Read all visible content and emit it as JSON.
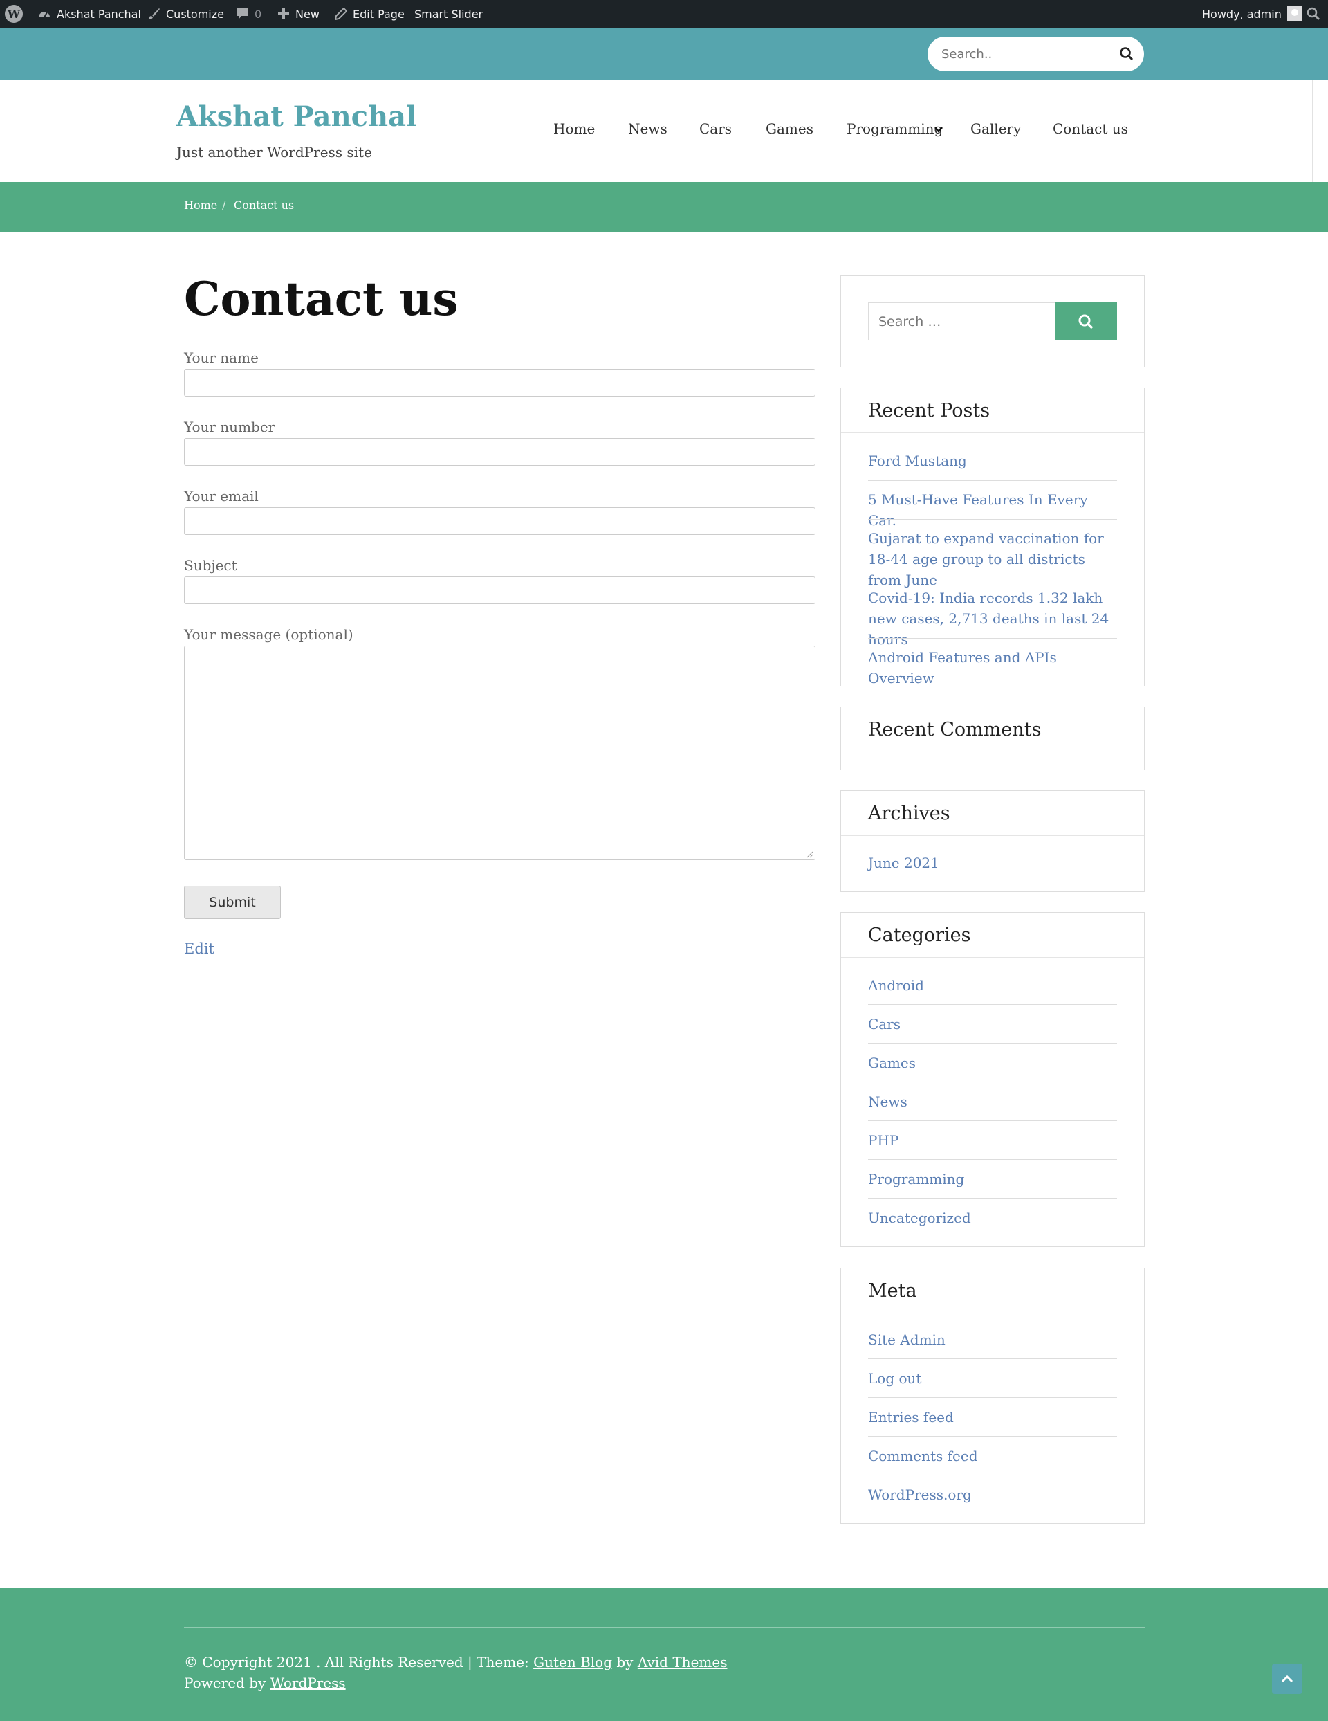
{
  "admin_bar": {
    "site_name": "Akshat Panchal",
    "customize": "Customize",
    "comments_count": "0",
    "new": "New",
    "edit_page": "Edit Page",
    "smart_slider": "Smart Slider",
    "howdy": "Howdy, admin"
  },
  "top_search": {
    "placeholder": "Search.."
  },
  "site": {
    "title": "Akshat Panchal",
    "tagline": "Just another WordPress site",
    "accent_color": "#56a5ae",
    "green_color": "#52ab83"
  },
  "nav": {
    "home": "Home",
    "news": "News",
    "cars": "Cars",
    "games": "Games",
    "programming": "Programming",
    "gallery": "Gallery",
    "contact": "Contact us"
  },
  "breadcrumb": {
    "home": "Home",
    "separator": "/",
    "current": "Contact us"
  },
  "page": {
    "title": "Contact us",
    "labels": {
      "name": "Your name",
      "number": "Your number",
      "email": "Your email",
      "subject": "Subject",
      "message": "Your message (optional)"
    },
    "submit": "Submit",
    "edit": "Edit"
  },
  "sidebar": {
    "search_placeholder": "Search …",
    "recent_posts": {
      "title": "Recent Posts",
      "items": [
        "Ford Mustang",
        "5 Must-Have Features In Every Car.",
        "Gujarat to expand vaccination for 18-44 age group to all districts from June",
        "Covid-19: India records 1.32 lakh new cases, 2,713 deaths in last 24 hours",
        "Android Features and APIs Overview"
      ]
    },
    "recent_comments": {
      "title": "Recent Comments"
    },
    "archives": {
      "title": "Archives",
      "items": [
        "June 2021"
      ]
    },
    "categories": {
      "title": "Categories",
      "items": [
        "Android",
        "Cars",
        "Games",
        "News",
        "PHP",
        "Programming",
        "Uncategorized"
      ]
    },
    "meta": {
      "title": "Meta",
      "items": [
        "Site Admin",
        "Log out",
        "Entries feed",
        "Comments feed",
        "WordPress.org"
      ]
    }
  },
  "footer": {
    "copyright": "© Copyright 2021 . All Rights Reserved | Theme:",
    "theme_link": "Guten Blog",
    "by": "by",
    "author_link": "Avid Themes",
    "powered_by": "Powered by",
    "wp_link": "WordPress"
  }
}
